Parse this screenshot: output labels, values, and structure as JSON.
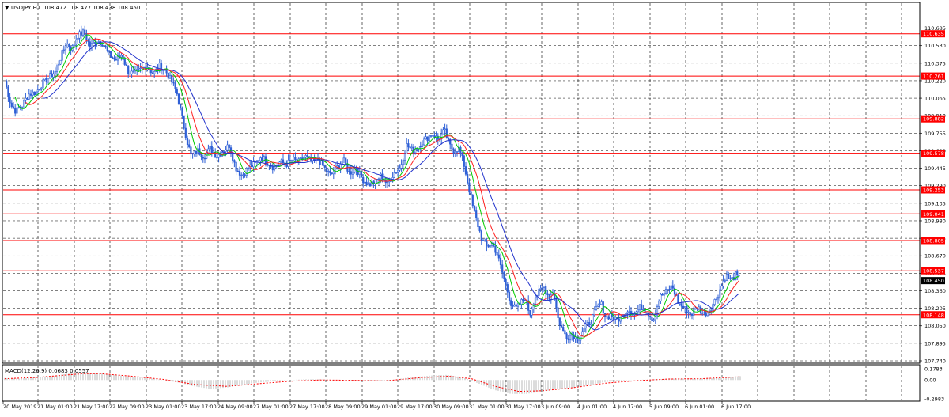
{
  "header": {
    "dropdown_icon": "triangle-down-icon",
    "symbol_label": "USDJPY,H1",
    "ohlc_label": "108.472 108.477 108.438 108.450"
  },
  "macd_label": "MACD(12,26,9) 0.0683 0.0557",
  "colors": {
    "candle": "#2e5fd6",
    "level_line": "#ff0000",
    "level_badge": "#ff0000",
    "ma_fast": "#00cc00",
    "ma_mid": "#ff2020",
    "ma_slow": "#2233cc",
    "macd_hist": "#b8b8b8",
    "macd_signal": "#ff0000",
    "current_badge": "#000000",
    "grid": "#000000"
  },
  "chart_data": [
    {
      "type": "candlestick",
      "symbol": "USDJPY",
      "timeframe": "H1",
      "y_range": [
        107.74,
        110.78
      ],
      "y_ticks": [
        "110.685",
        "110.530",
        "110.375",
        "110.220",
        "110.065",
        "109.910",
        "109.755",
        "109.600",
        "109.445",
        "109.290",
        "109.135",
        "108.980",
        "108.825",
        "108.670",
        "108.515",
        "108.360",
        "108.205",
        "108.050",
        "107.895",
        "107.740"
      ],
      "x_labels": [
        "20 May 2019",
        "21 May 01:00",
        "21 May 17:00",
        "22 May 09:00",
        "23 May 01:00",
        "23 May 17:00",
        "24 May 09:00",
        "27 May 01:00",
        "27 May 17:00",
        "28 May 09:00",
        "29 May 01:00",
        "29 May 17:00",
        "30 May 09:00",
        "31 May 01:00",
        "31 May 17:00",
        "3 Jun 09:00",
        "4 Jun 01:00",
        "4 Jun 17:00",
        "5 Jun 09:00",
        "6 Jun 01:00",
        "6 Jun 17:00"
      ],
      "grid": true,
      "horizontal_levels": [
        110.635,
        110.261,
        109.882,
        109.578,
        109.253,
        109.041,
        108.805,
        108.537,
        108.148
      ],
      "horizontal_level_labels": [
        "110.635",
        "110.261",
        "109.882",
        "109.578",
        "109.253",
        "109.041",
        "108.805",
        "108.537",
        "108.148"
      ],
      "current_price": 108.45,
      "current_price_label": "108.450",
      "close_path": [
        [
          0,
          110.22
        ],
        [
          8,
          110.0
        ],
        [
          14,
          109.95
        ],
        [
          22,
          110.0
        ],
        [
          30,
          110.1
        ],
        [
          40,
          110.12
        ],
        [
          48,
          110.2
        ],
        [
          56,
          110.25
        ],
        [
          64,
          110.3
        ],
        [
          72,
          110.45
        ],
        [
          78,
          110.55
        ],
        [
          85,
          110.5
        ],
        [
          92,
          110.62
        ],
        [
          100,
          110.65
        ],
        [
          108,
          110.52
        ],
        [
          116,
          110.58
        ],
        [
          124,
          110.55
        ],
        [
          132,
          110.45
        ],
        [
          140,
          110.4
        ],
        [
          148,
          110.45
        ],
        [
          156,
          110.3
        ],
        [
          164,
          110.28
        ],
        [
          172,
          110.32
        ],
        [
          180,
          110.35
        ],
        [
          188,
          110.28
        ],
        [
          196,
          110.35
        ],
        [
          204,
          110.3
        ],
        [
          212,
          110.2
        ],
        [
          218,
          110.1
        ],
        [
          224,
          109.9
        ],
        [
          230,
          109.7
        ],
        [
          236,
          109.55
        ],
        [
          244,
          109.6
        ],
        [
          252,
          109.55
        ],
        [
          260,
          109.62
        ],
        [
          268,
          109.55
        ],
        [
          276,
          109.6
        ],
        [
          284,
          109.65
        ],
        [
          292,
          109.45
        ],
        [
          300,
          109.38
        ],
        [
          308,
          109.45
        ],
        [
          316,
          109.48
        ],
        [
          324,
          109.55
        ],
        [
          332,
          109.5
        ],
        [
          340,
          109.45
        ],
        [
          348,
          109.5
        ],
        [
          356,
          109.48
        ],
        [
          364,
          109.52
        ],
        [
          372,
          109.5
        ],
        [
          380,
          109.55
        ],
        [
          388,
          109.5
        ],
        [
          396,
          109.52
        ],
        [
          404,
          109.45
        ],
        [
          412,
          109.38
        ],
        [
          420,
          109.45
        ],
        [
          428,
          109.52
        ],
        [
          436,
          109.4
        ],
        [
          444,
          109.45
        ],
        [
          452,
          109.35
        ],
        [
          460,
          109.3
        ],
        [
          468,
          109.32
        ],
        [
          476,
          109.38
        ],
        [
          484,
          109.3
        ],
        [
          492,
          109.4
        ],
        [
          500,
          109.45
        ],
        [
          508,
          109.65
        ],
        [
          516,
          109.6
        ],
        [
          524,
          109.65
        ],
        [
          532,
          109.7
        ],
        [
          540,
          109.75
        ],
        [
          548,
          109.7
        ],
        [
          556,
          109.78
        ],
        [
          562,
          109.65
        ],
        [
          568,
          109.6
        ],
        [
          574,
          109.62
        ],
        [
          580,
          109.5
        ],
        [
          586,
          109.3
        ],
        [
          592,
          109.1
        ],
        [
          598,
          108.95
        ],
        [
          604,
          108.8
        ],
        [
          610,
          108.75
        ],
        [
          616,
          108.78
        ],
        [
          622,
          108.7
        ],
        [
          628,
          108.55
        ],
        [
          634,
          108.4
        ],
        [
          640,
          108.25
        ],
        [
          646,
          108.2
        ],
        [
          652,
          108.25
        ],
        [
          658,
          108.3
        ],
        [
          664,
          108.15
        ],
        [
          670,
          108.3
        ],
        [
          676,
          108.35
        ],
        [
          682,
          108.4
        ],
        [
          688,
          108.3
        ],
        [
          694,
          108.35
        ],
        [
          700,
          108.1
        ],
        [
          706,
          108.0
        ],
        [
          712,
          107.95
        ],
        [
          718,
          107.98
        ],
        [
          724,
          107.92
        ],
        [
          730,
          108.0
        ],
        [
          736,
          108.05
        ],
        [
          742,
          108.1
        ],
        [
          748,
          108.2
        ],
        [
          754,
          108.25
        ],
        [
          760,
          108.12
        ],
        [
          766,
          108.15
        ],
        [
          772,
          108.1
        ],
        [
          780,
          108.12
        ],
        [
          788,
          108.2
        ],
        [
          796,
          108.15
        ],
        [
          804,
          108.22
        ],
        [
          812,
          108.18
        ],
        [
          820,
          108.1
        ],
        [
          828,
          108.3
        ],
        [
          836,
          108.35
        ],
        [
          844,
          108.4
        ],
        [
          852,
          108.25
        ],
        [
          860,
          108.2
        ],
        [
          868,
          108.15
        ],
        [
          876,
          108.22
        ],
        [
          884,
          108.15
        ],
        [
          892,
          108.2
        ],
        [
          900,
          108.3
        ],
        [
          906,
          108.4
        ],
        [
          912,
          108.5
        ],
        [
          918,
          108.45
        ],
        [
          924,
          108.5
        ],
        [
          930,
          108.45
        ]
      ]
    },
    {
      "type": "line",
      "name": "MACD",
      "y_range": [
        -0.2983,
        0.1783
      ],
      "y_ticks": [
        "0.1783",
        "0.00",
        "-0.2983"
      ],
      "series": [
        {
          "values": [
            [
              0,
              0.03
            ],
            [
              20,
              0.02
            ],
            [
              40,
              0.05
            ],
            [
              60,
              0.06
            ],
            [
              80,
              0.1
            ],
            [
              100,
              0.12
            ],
            [
              120,
              0.11
            ],
            [
              140,
              0.08
            ],
            [
              160,
              0.05
            ],
            [
              180,
              0.03
            ],
            [
              200,
              0.0
            ],
            [
              220,
              -0.04
            ],
            [
              240,
              -0.1
            ],
            [
              260,
              -0.14
            ],
            [
              280,
              -0.12
            ],
            [
              300,
              -0.08
            ],
            [
              320,
              -0.04
            ],
            [
              340,
              -0.02
            ],
            [
              360,
              0.0
            ],
            [
              380,
              0.01
            ],
            [
              400,
              0.01
            ],
            [
              420,
              0.0
            ],
            [
              440,
              -0.01
            ],
            [
              460,
              -0.02
            ],
            [
              480,
              -0.02
            ],
            [
              500,
              0.02
            ],
            [
              520,
              0.05
            ],
            [
              540,
              0.07
            ],
            [
              560,
              0.08
            ],
            [
              580,
              0.04
            ],
            [
              600,
              -0.06
            ],
            [
              620,
              -0.16
            ],
            [
              640,
              -0.22
            ],
            [
              660,
              -0.22
            ],
            [
              680,
              -0.18
            ],
            [
              700,
              -0.14
            ],
            [
              720,
              -0.12
            ],
            [
              740,
              -0.08
            ],
            [
              760,
              -0.03
            ],
            [
              780,
              -0.01
            ],
            [
              800,
              0.0
            ],
            [
              820,
              0.01
            ],
            [
              840,
              0.02
            ],
            [
              860,
              0.02
            ],
            [
              880,
              0.02
            ],
            [
              900,
              0.03
            ],
            [
              920,
              0.05
            ],
            [
              930,
              0.06
            ]
          ]
        }
      ],
      "signal": [
        [
          0,
          0.02
        ],
        [
          40,
          0.04
        ],
        [
          80,
          0.08
        ],
        [
          100,
          0.1
        ],
        [
          120,
          0.1
        ],
        [
          160,
          0.06
        ],
        [
          200,
          0.01
        ],
        [
          240,
          -0.07
        ],
        [
          280,
          -0.1
        ],
        [
          320,
          -0.06
        ],
        [
          360,
          -0.02
        ],
        [
          400,
          0.0
        ],
        [
          440,
          -0.005
        ],
        [
          480,
          -0.015
        ],
        [
          520,
          0.03
        ],
        [
          560,
          0.06
        ],
        [
          590,
          0.02
        ],
        [
          620,
          -0.1
        ],
        [
          650,
          -0.18
        ],
        [
          680,
          -0.17
        ],
        [
          720,
          -0.12
        ],
        [
          760,
          -0.05
        ],
        [
          800,
          -0.01
        ],
        [
          840,
          0.015
        ],
        [
          880,
          0.02
        ],
        [
          930,
          0.05
        ]
      ]
    }
  ]
}
